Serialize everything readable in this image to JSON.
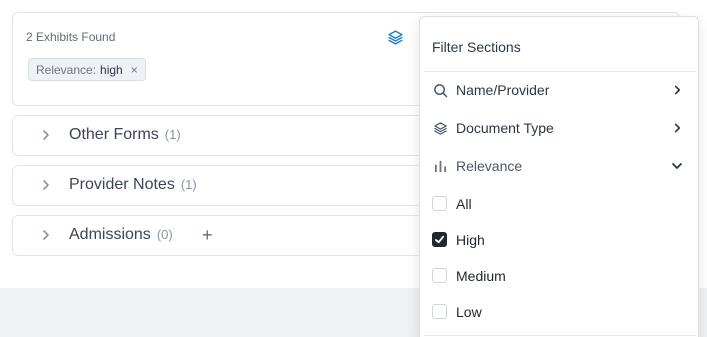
{
  "summary": {
    "exhibits_found": "2 Exhibits Found",
    "filter_chip": {
      "label": "Relevance:",
      "value": "high",
      "remove": "×"
    }
  },
  "sections": [
    {
      "title": "Other Forms",
      "count": "(1)"
    },
    {
      "title": "Provider Notes",
      "count": "(1)"
    },
    {
      "title": "Admissions",
      "count": "(0)",
      "add": "+"
    }
  ],
  "filter_panel": {
    "title": "Filter Sections",
    "items": [
      {
        "label": "Name/Provider",
        "icon": "search-icon",
        "expanded": false
      },
      {
        "label": "Document Type",
        "icon": "layers-icon",
        "expanded": false
      },
      {
        "label": "Relevance",
        "icon": "bar-chart-icon",
        "expanded": true
      }
    ],
    "relevance_options": [
      {
        "label": "All",
        "checked": false
      },
      {
        "label": "High",
        "checked": true
      },
      {
        "label": "Medium",
        "checked": false
      },
      {
        "label": "Low",
        "checked": false
      }
    ]
  },
  "colors": {
    "accent": "#1a7fd1",
    "text": "#2d3748",
    "muted": "#8a94a2",
    "checkbox_checked": "#1f2733"
  }
}
